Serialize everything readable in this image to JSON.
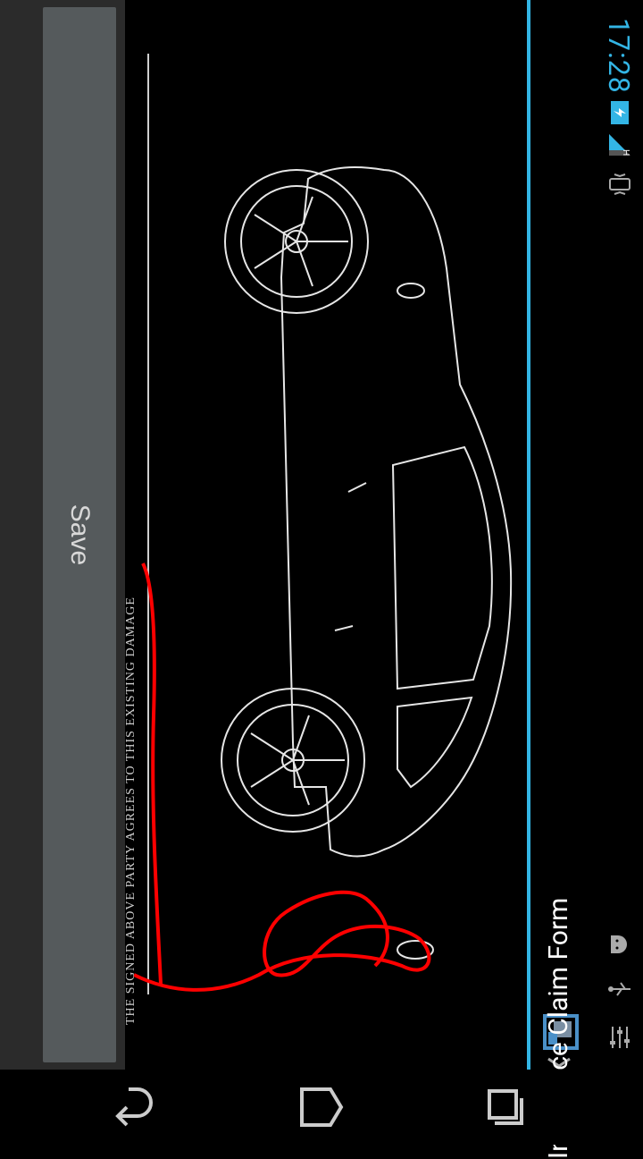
{
  "status_bar": {
    "time": "17:28",
    "network": "H",
    "icons": [
      "vibrate-icon",
      "signal-icon",
      "battery-icon",
      "settings-sliders-icon",
      "usb-icon",
      "android-debug-icon"
    ]
  },
  "action_bar": {
    "title": "Insurance Claim Form",
    "app_icon": "document-icon"
  },
  "form": {
    "disclaimer": "THE SIGNED ABOVE PARTY AGREES TO THIS EXISTING DAMAGE",
    "signature_color": "#ff0000"
  },
  "footer": {
    "save_label": "Save"
  },
  "nav_bar": {
    "buttons": [
      "back-icon",
      "home-icon",
      "recents-icon"
    ]
  },
  "colors": {
    "accent": "#33b5e5",
    "background": "#000000",
    "button": "#555a5c"
  }
}
